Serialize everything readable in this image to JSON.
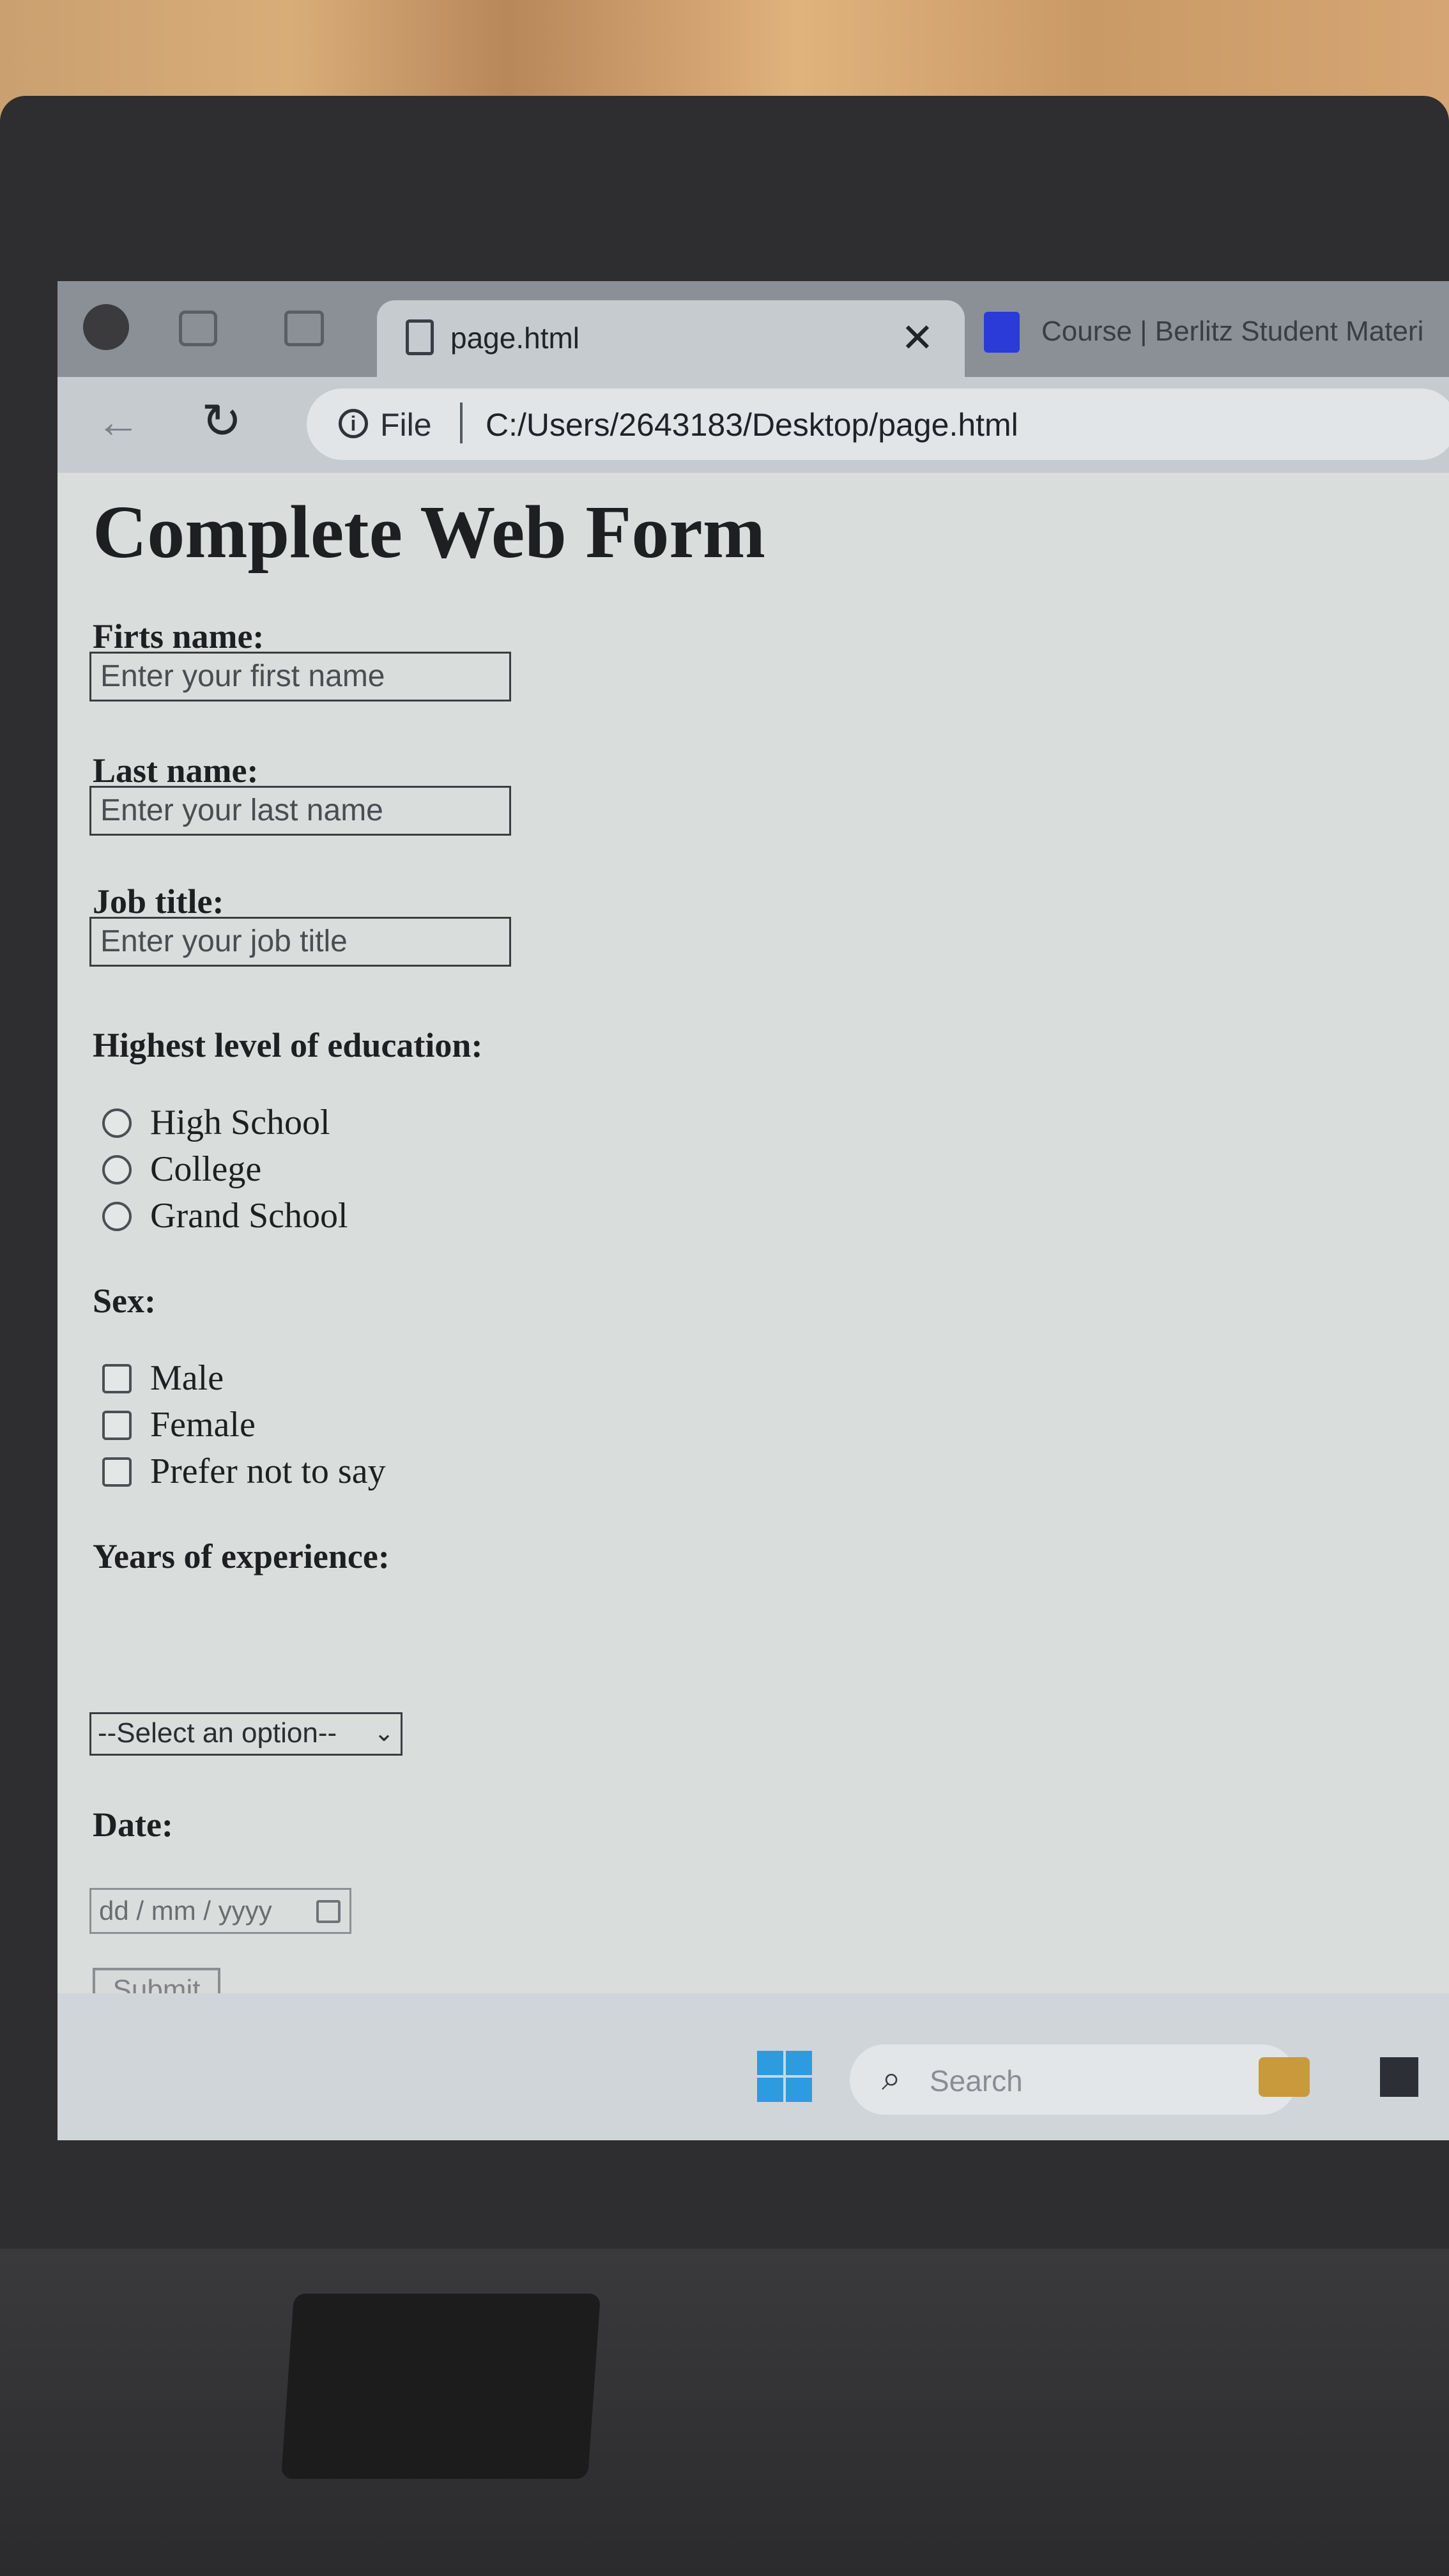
{
  "browser": {
    "tabs": [
      {
        "title": "page.html",
        "close": "✕",
        "active": true
      },
      {
        "title": "Course | Berlitz Student Materi",
        "active": false
      }
    ],
    "toolbar": {
      "back": "←",
      "reload": "↻",
      "info": "i",
      "scheme": "File",
      "url": "C:/Users/2643183/Desktop/page.html"
    }
  },
  "page": {
    "title": "Complete Web Form",
    "first_name": {
      "label": "Firts name:",
      "placeholder": "Enter your first name"
    },
    "last_name": {
      "label": "Last name:",
      "placeholder": "Enter your last name"
    },
    "job_title": {
      "label": "Job title:",
      "placeholder": "Enter your job title"
    },
    "education": {
      "label": "Highest level of education:",
      "options": [
        "High School",
        "College",
        "Grand School"
      ]
    },
    "sex": {
      "label": "Sex:",
      "options": [
        "Male",
        "Female",
        "Prefer not to say"
      ]
    },
    "experience": {
      "label": "Years of experience:",
      "selected": "--Select an option--",
      "chevron": "⌄"
    },
    "date": {
      "label": "Date:",
      "placeholder": "dd / mm / yyyy"
    },
    "submit": "Submit"
  },
  "taskbar": {
    "search_icon": "⌕",
    "search_placeholder": "Search"
  },
  "colors": {
    "page_bg": "#d9dedc",
    "tab_strip": "#8a9096",
    "start_blue": "#2d9be0",
    "tab2_icon": "#2a3bd8"
  }
}
